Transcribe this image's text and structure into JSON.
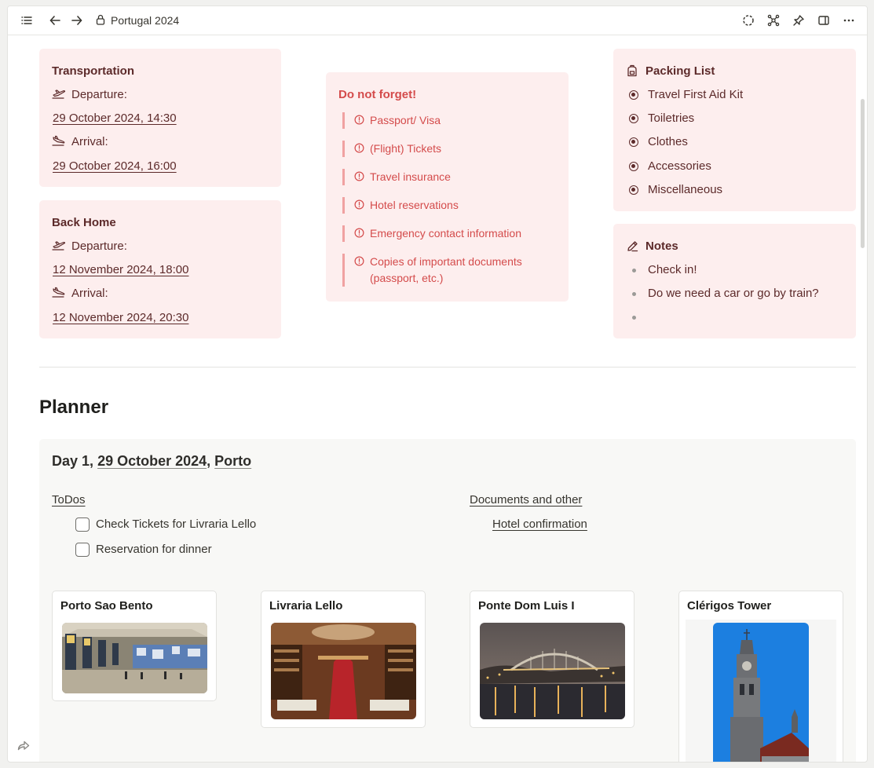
{
  "topbar": {
    "title": "Portugal 2024",
    "icons": [
      "list-icon",
      "back-arrow-icon",
      "forward-arrow-icon",
      "lock-icon",
      "sync-icon",
      "graph-icon",
      "pin-icon",
      "sidebar-icon",
      "more-icon"
    ]
  },
  "transportation": {
    "title": "Transportation",
    "departure_label": "Departure:",
    "departure_date": "29 October 2024, 14:30",
    "arrival_label": "Arrival:",
    "arrival_date": "29 October 2024, 16:00"
  },
  "back_home": {
    "title": "Back Home",
    "departure_label": "Departure:",
    "departure_date": "12 November 2024, 18:00",
    "arrival_label": "Arrival:",
    "arrival_date": "12 November 2024, 20:30"
  },
  "do_not_forget": {
    "title": "Do not forget!",
    "items": [
      "Passport/ Visa",
      "(Flight) Tickets",
      "Travel insurance",
      "Hotel reservations",
      "Emergency contact information",
      "Copies of important documents (passport, etc.)"
    ]
  },
  "packing_list": {
    "title": "Packing List",
    "items": [
      "Travel First Aid Kit",
      "Toiletries",
      "Clothes",
      "Accessories",
      "Miscellaneous"
    ]
  },
  "notes": {
    "title": "Notes",
    "items": [
      "Check in!",
      "Do we need a car or go by train?",
      ""
    ]
  },
  "planner": {
    "heading": "Planner",
    "day_prefix": "Day 1,",
    "day_date": "29 October 2024",
    "day_sep": ",",
    "day_city": "Porto",
    "todos_label": "ToDos",
    "todos": [
      {
        "label": "Check Tickets for Livraria Lello",
        "checked": false
      },
      {
        "label": "Reservation for dinner",
        "checked": false
      }
    ],
    "docs_label": "Documents and other",
    "docs": [
      "Hotel confirmation"
    ],
    "places": [
      "Porto Sao Bento",
      "Livraria Lello",
      "Ponte Dom Luis I",
      "Clérigos Tower"
    ]
  },
  "colors": {
    "card_bg": "#fdeeee",
    "card_text": "#5c2a2a",
    "alert": "#d44b4b",
    "alert_bar": "#f0a1a1",
    "block_bg": "#f8f8f6"
  }
}
